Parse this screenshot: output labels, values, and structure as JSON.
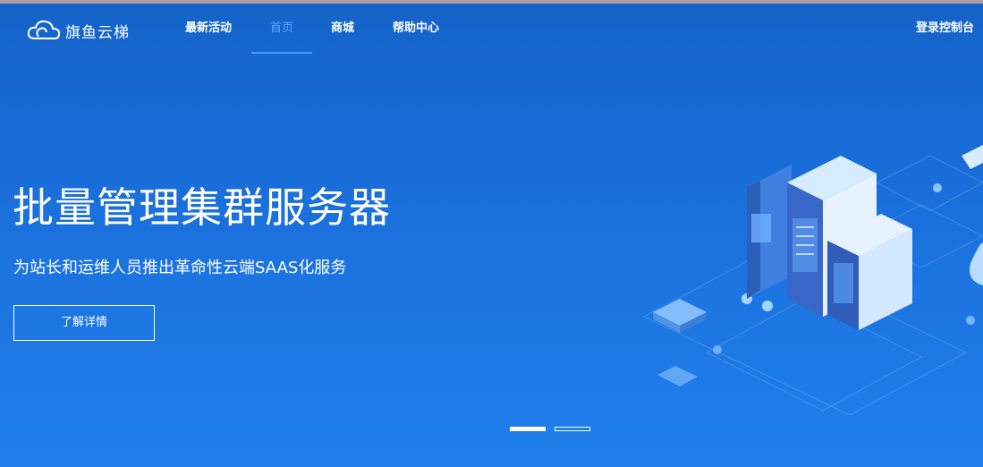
{
  "brand": {
    "name": "旗鱼云梯"
  },
  "nav": {
    "items": [
      {
        "label": "最新活动",
        "active": false
      },
      {
        "label": "首页",
        "active": true
      },
      {
        "label": "商城",
        "active": false
      },
      {
        "label": "帮助中心",
        "active": false
      }
    ],
    "login_label": "登录控制台"
  },
  "hero": {
    "title": "批量管理集群服务器",
    "subtitle": "为站长和运维人员推出革命性云端SAAS化服务",
    "cta_label": "了解详情",
    "slides": {
      "count": 2,
      "active_index": 0
    }
  },
  "icons": {
    "logo": "cloud-logo-icon",
    "illustration": "server-cluster-illustration"
  },
  "colors": {
    "hero_top": "#1463c9",
    "hero_bottom": "#2180ec",
    "nav_active": "#5aa8ff",
    "text": "#ffffff"
  }
}
